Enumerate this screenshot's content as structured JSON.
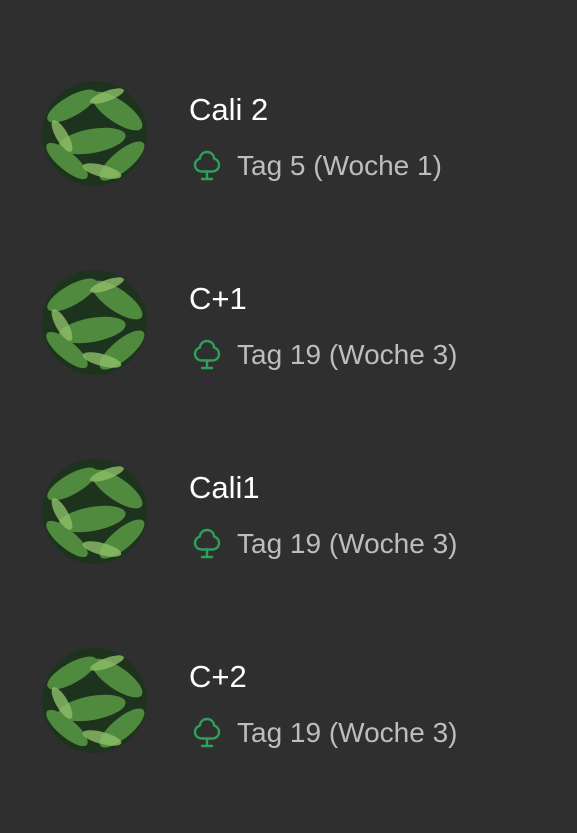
{
  "accent_color": "#2ea05a",
  "items": [
    {
      "title": "Cali 2",
      "subtitle": "Tag 5 (Woche 1)",
      "avatar_icon": "fern-leaves-image",
      "status_icon": "tree-icon"
    },
    {
      "title": "C+1",
      "subtitle": "Tag 19 (Woche 3)",
      "avatar_icon": "fern-leaves-image",
      "status_icon": "tree-icon"
    },
    {
      "title": "Cali1",
      "subtitle": "Tag 19 (Woche 3)",
      "avatar_icon": "fern-leaves-image",
      "status_icon": "tree-icon"
    },
    {
      "title": "C+2",
      "subtitle": "Tag 19 (Woche 3)",
      "avatar_icon": "fern-leaves-image",
      "status_icon": "tree-icon"
    }
  ]
}
